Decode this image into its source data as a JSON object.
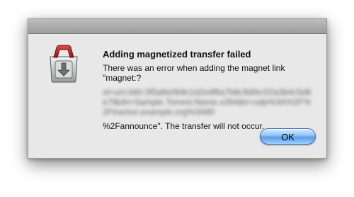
{
  "dialog": {
    "title": "Adding magnetized transfer failed",
    "message_start": "There was an error when adding the magnet link \"magnet:?",
    "message_obscured": "xt=urn:btih:3f5a8e0b9c1d2e4f6a7b8c9d0e1f2a3b4c5d6e7f&dn=Sample.Torrent.Name.x264&tr=udp%3A%2F%2Ftracker.example.org%3A80",
    "message_end": "%2Fannounce\". The transfer will not occur.",
    "ok_label": "OK"
  },
  "colors": {
    "button_accent": "#5a9ce8",
    "icon_red": "#c0282a"
  },
  "icons": {
    "app_icon": "transmission-icon"
  }
}
